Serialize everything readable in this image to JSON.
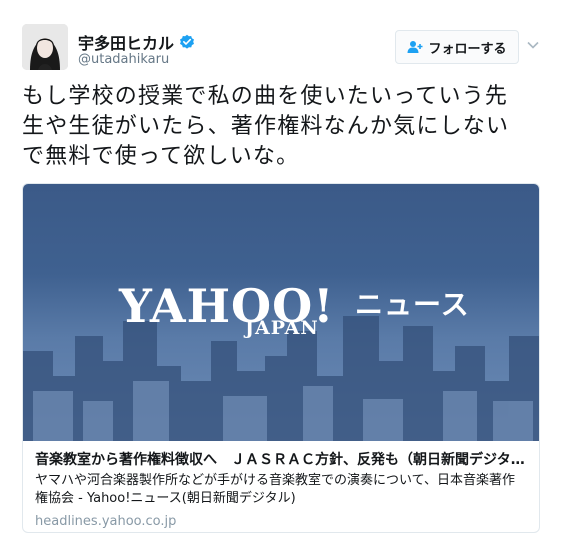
{
  "user": {
    "display_name": "宇多田ヒカル",
    "handle": "@utadahikaru",
    "verified": true
  },
  "follow_button": {
    "label": "フォローする"
  },
  "tweet": {
    "lines": [
      "もし学校の授業で私の曲を使いたいっていう先",
      "生や生徒がいたら、著作権料なんか気にしない",
      "で無料で使って欲しいな。"
    ]
  },
  "card": {
    "logo": {
      "brand": "YAHOO!",
      "sub": "JAPAN",
      "service": "ニュース"
    },
    "title": "音楽教室から著作権料徴収へ　ＪＡＳＲＡＣ方針、反発も（朝日新聞デジタル） - ...",
    "description": "ヤマハや河合楽器製作所などが手がける音楽教室での演奏について、日本音楽著作権協会 - Yahoo!ニュース(朝日新聞デジタル)",
    "domain": "headlines.yahoo.co.jp"
  },
  "colors": {
    "verified": "#1da1f2",
    "follow_icon": "#1da1f2",
    "secondary_text": "#657786"
  },
  "icons": {
    "verified": "verified-badge-icon",
    "follow": "add-user-icon",
    "more": "chevron-down-icon"
  }
}
